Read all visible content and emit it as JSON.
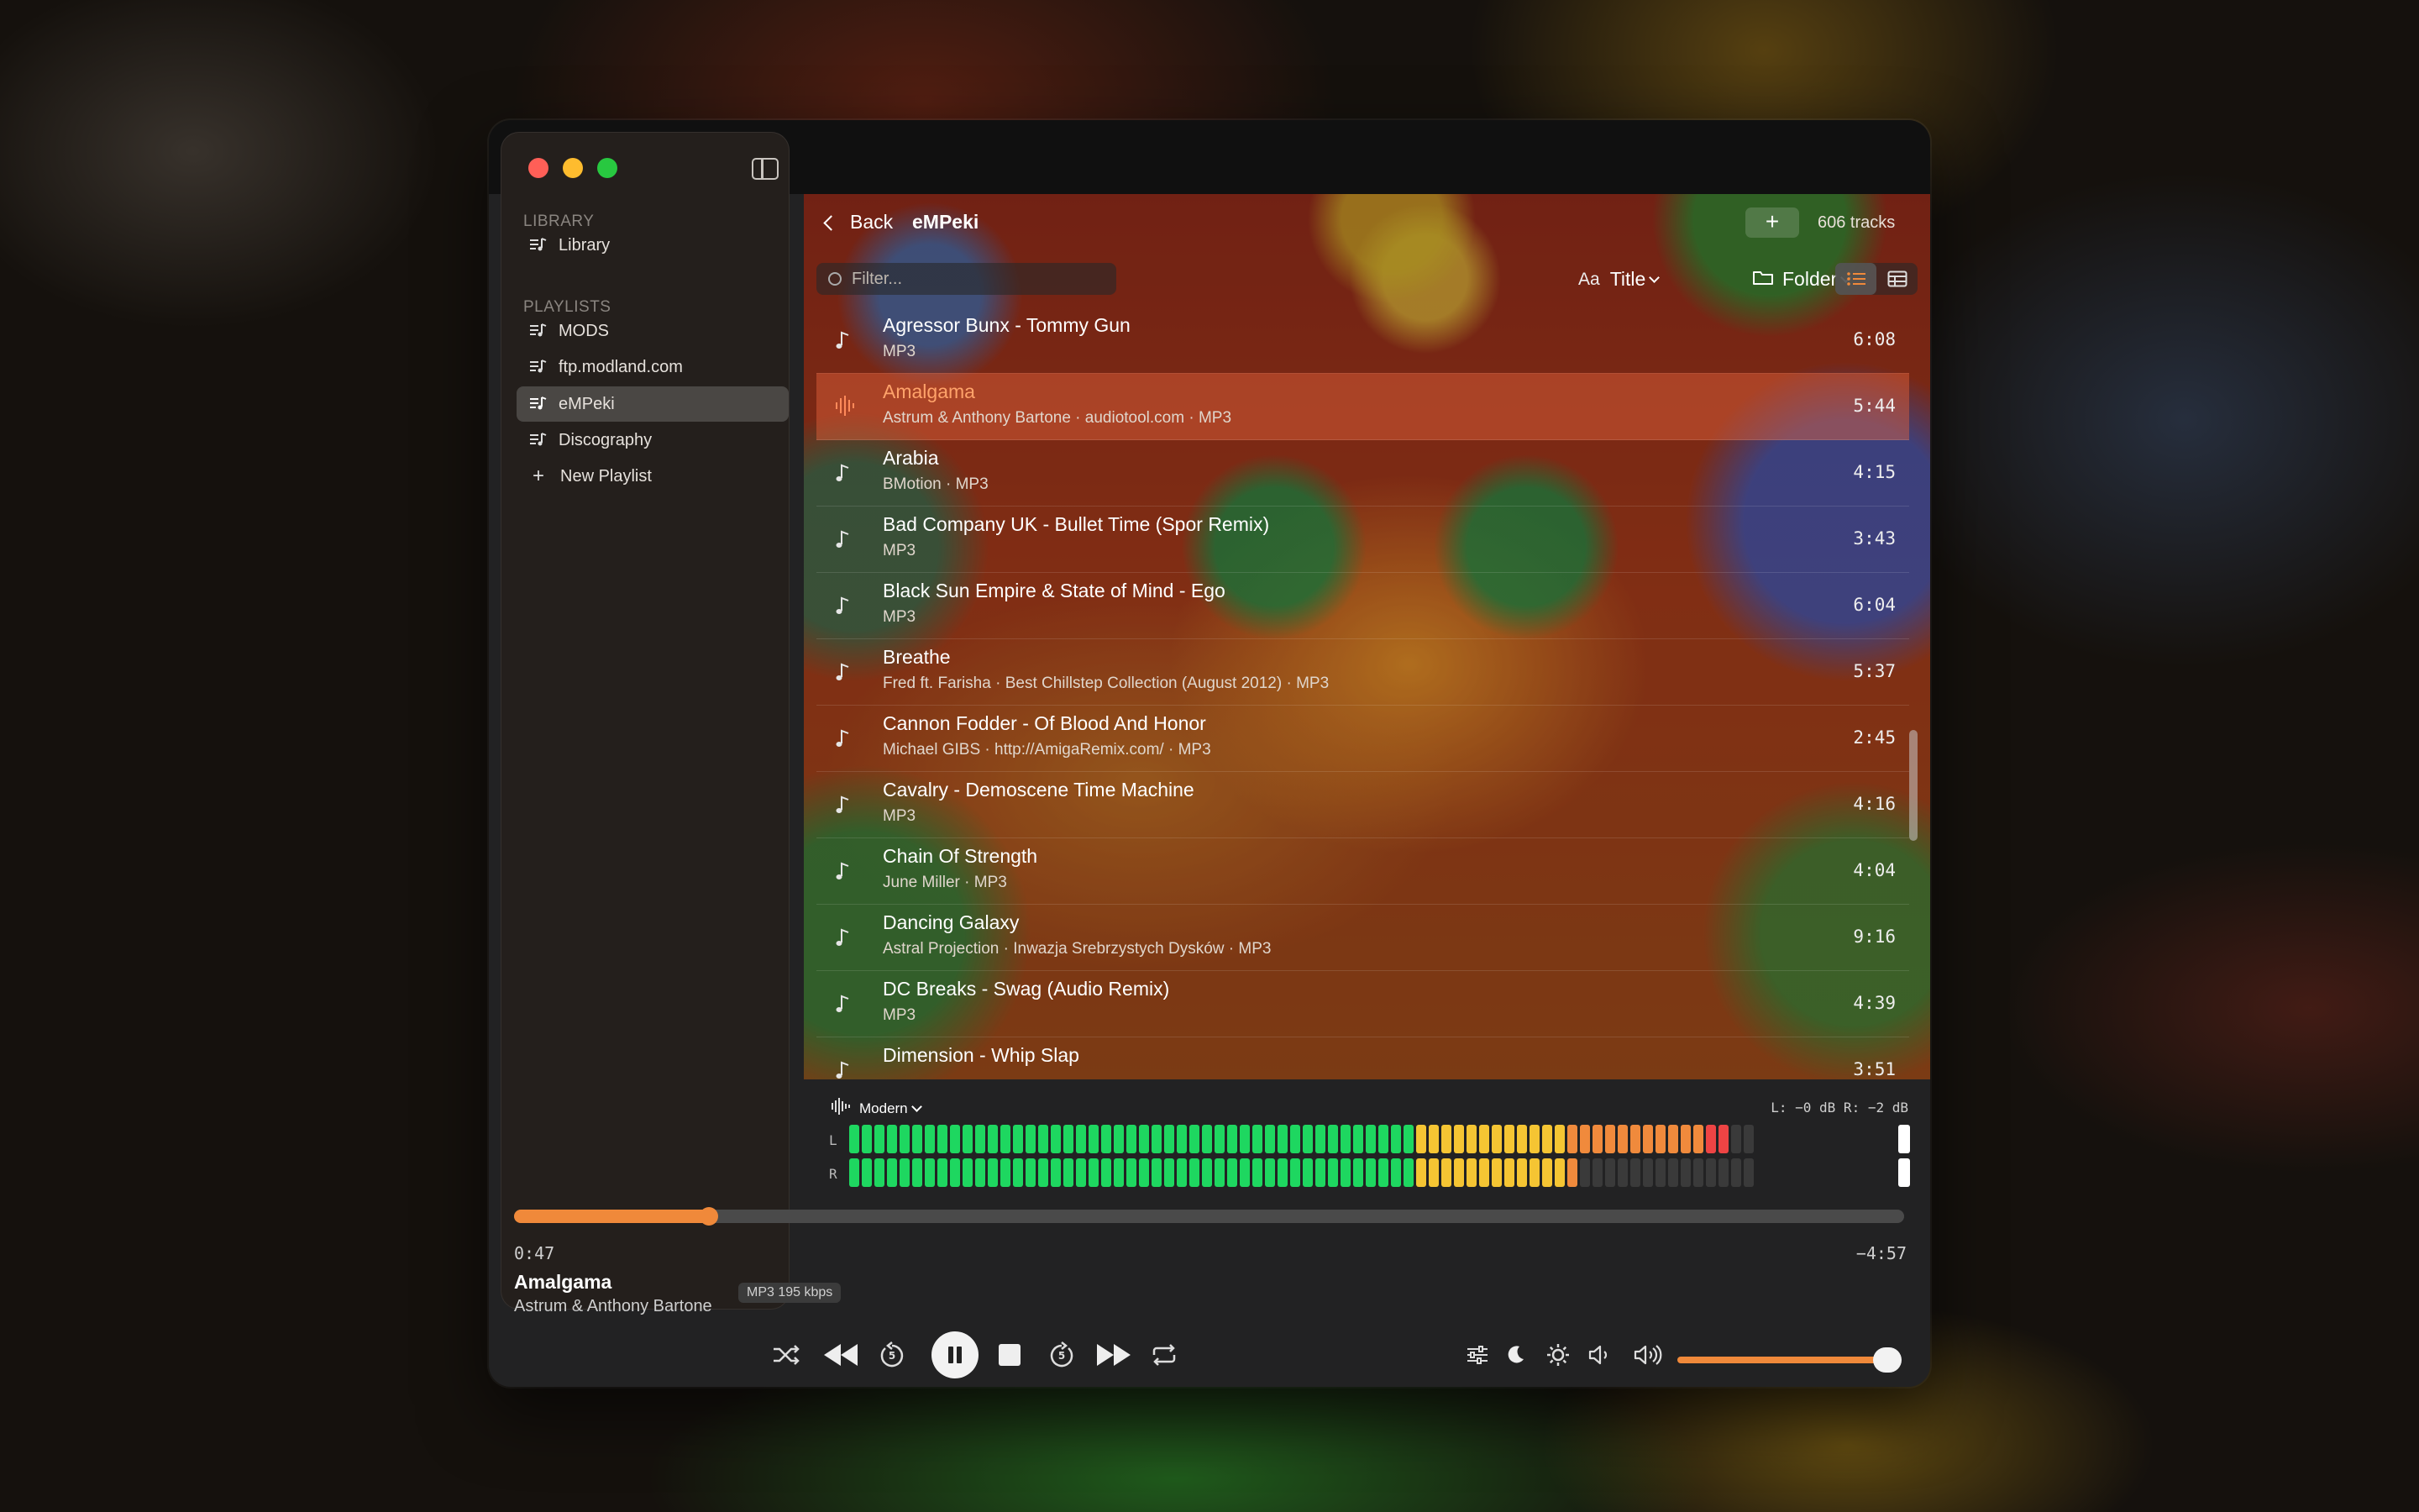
{
  "sidebar": {
    "library_section": "LIBRARY",
    "library_item": "Library",
    "playlists_section": "PLAYLISTS",
    "playlists": [
      "MODS",
      "ftp.modland.com",
      "eMPeki",
      "Discography"
    ],
    "active_playlist": "eMPeki",
    "new_playlist": "New Playlist"
  },
  "header": {
    "back_label": "Back",
    "playlist_name": "eMPeki",
    "add_label": "+",
    "track_count": "606 tracks"
  },
  "toolbar": {
    "filter_placeholder": "Filter...",
    "sort_prefix": "Aa",
    "sort_label": "Title",
    "group_label": "Folder",
    "view_mode": "list"
  },
  "tracks": [
    {
      "title": "Agressor Bunx - Tommy Gun",
      "meta": "MP3",
      "duration": "6:08",
      "playing": false
    },
    {
      "title": "Amalgama",
      "meta": "Astrum & Anthony Bartone  ·  audiotool.com  ·  MP3",
      "duration": "5:44",
      "playing": true
    },
    {
      "title": "Arabia",
      "meta": "BMotion  ·  MP3",
      "duration": "4:15",
      "playing": false
    },
    {
      "title": "Bad Company UK - Bullet Time (Spor Remix)",
      "meta": "MP3",
      "duration": "3:43",
      "playing": false
    },
    {
      "title": "Black Sun Empire & State of Mind - Ego",
      "meta": "MP3",
      "duration": "6:04",
      "playing": false
    },
    {
      "title": "Breathe",
      "meta": "Fred ft. Farisha  ·  Best Chillstep Collection (August 2012)  ·  MP3",
      "duration": "5:37",
      "playing": false
    },
    {
      "title": "Cannon Fodder - Of Blood And Honor",
      "meta": "Michael GIBS  ·  http://AmigaRemix.com/  ·  MP3",
      "duration": "2:45",
      "playing": false
    },
    {
      "title": "Cavalry - Demoscene Time Machine",
      "meta": "MP3",
      "duration": "4:16",
      "playing": false
    },
    {
      "title": "Chain Of Strength",
      "meta": "June Miller  ·  MP3",
      "duration": "4:04",
      "playing": false
    },
    {
      "title": "Dancing Galaxy",
      "meta": "Astral Projection  ·  Inwazja Srebrzystych Dysków  ·  MP3",
      "duration": "9:16",
      "playing": false
    },
    {
      "title": "DC Breaks - Swag (Audio Remix)",
      "meta": "MP3",
      "duration": "4:39",
      "playing": false
    },
    {
      "title": "Dimension - Whip Slap",
      "meta": "",
      "duration": "3:51",
      "playing": false
    }
  ],
  "meter": {
    "mode_label": "Modern",
    "db_readout": "L: −0 dB  R: −2 dB",
    "left_label": "L",
    "right_label": "R",
    "left_level": 0.97,
    "right_level": 0.81,
    "colors": {
      "green": "#1ed760",
      "yellow": "#f5c533",
      "orange": "#f08a3c",
      "red": "#ee4444",
      "off": "#3a3a3a"
    }
  },
  "player": {
    "elapsed": "0:47",
    "remaining": "−4:57",
    "progress": 0.14,
    "now_title": "Amalgama",
    "now_artist": "Astrum & Anthony Bartone",
    "format_badge": "MP3 195 kbps",
    "volume": 0.97,
    "is_playing": true
  },
  "accent_color": "#f0893a"
}
